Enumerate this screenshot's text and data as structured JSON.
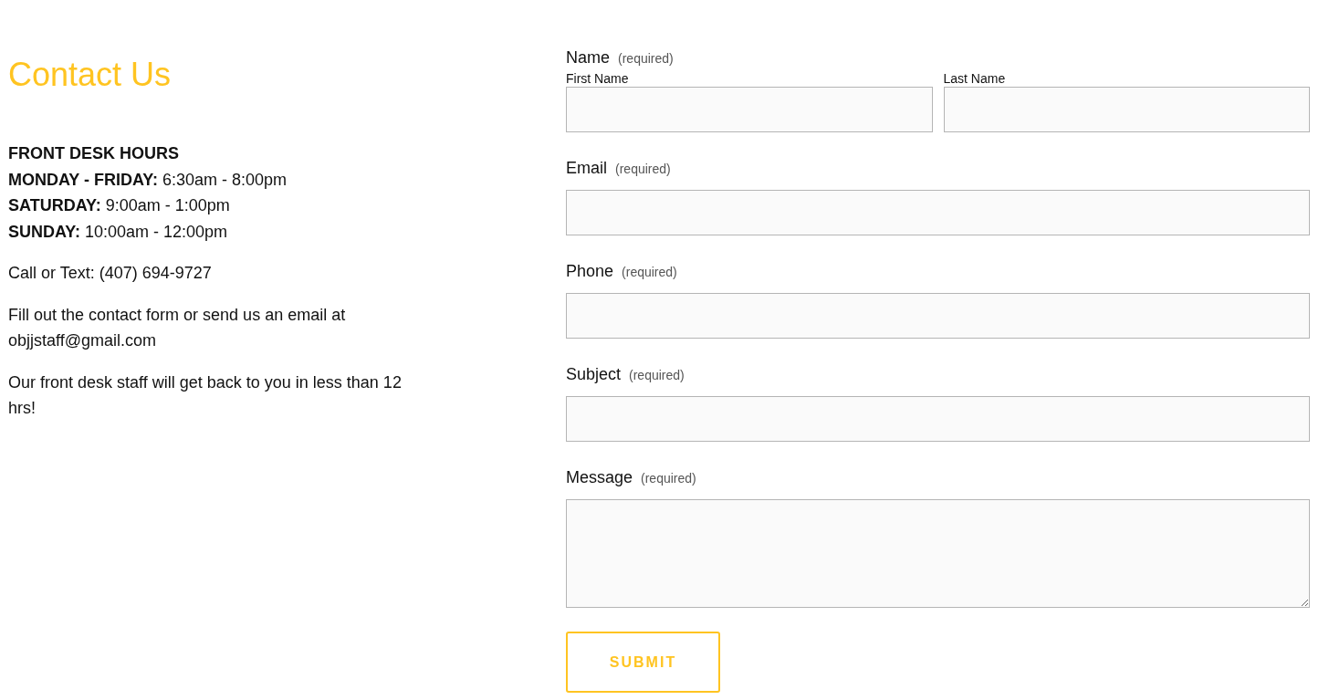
{
  "contact": {
    "title": "Contact Us",
    "hours_heading": "FRONT DESK HOURS",
    "hours": [
      "**MONDAY - FRIDAY:** 6:30am - 8:00pm",
      "**SATURDAY:** 9:00am - 1:00pm",
      "**SUNDAY:** 10:00am - 12:00pm"
    ],
    "paragraphs": [
      "Call or Text: (407) 694-9727",
      "Fill out the contact form or send us an email at objjstaff@gmail.com",
      "Our front desk staff will get back to you in less than 12 hrs!"
    ]
  },
  "form": {
    "fields": [
      {
        "kind": "split",
        "label": "Name",
        "note": "(required)",
        "parts": [
          {
            "label": "First Name"
          },
          {
            "label": "Last Name"
          }
        ]
      },
      {
        "kind": "text",
        "label": "Email",
        "note": "(required)"
      },
      {
        "kind": "text",
        "label": "Phone",
        "note": "(required)"
      },
      {
        "kind": "text",
        "label": "Subject",
        "note": "(required)"
      },
      {
        "kind": "textarea",
        "label": "Message",
        "note": "(required)"
      }
    ],
    "submit": "SUBMIT"
  }
}
